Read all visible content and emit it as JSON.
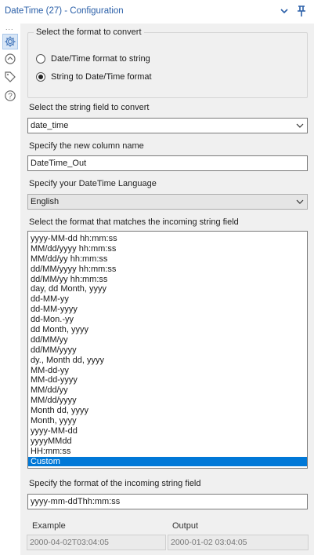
{
  "header": {
    "title": "DateTime (27) - Configuration",
    "collapse_icon": "chevron-down-icon",
    "pin_icon": "pin-icon"
  },
  "sidebar": {
    "more": "...",
    "icons": [
      "gear-icon",
      "connection-icon",
      "tag-icon",
      "help-icon"
    ]
  },
  "config": {
    "group_title": "Select the format to convert",
    "radio_options": [
      {
        "label": "Date/Time format to string",
        "selected": false
      },
      {
        "label": "String to Date/Time format",
        "selected": true
      }
    ],
    "string_field_label": "Select the string field to convert",
    "string_field_value": "date_time",
    "new_column_label": "Specify the new column name",
    "new_column_value": "DateTime_Out",
    "language_label": "Specify your DateTime Language",
    "language_value": "English",
    "format_list_label": "Select the format that matches the incoming string field",
    "formats": [
      "yyyy-MM-dd hh:mm:ss",
      "MM/dd/yyyy hh:mm:ss",
      "MM/dd/yy hh:mm:ss",
      "dd/MM/yyyy hh:mm:ss",
      "dd/MM/yy hh:mm:ss",
      "day, dd Month, yyyy",
      "dd-MM-yy",
      "dd-MM-yyyy",
      "dd-Mon.-yy",
      "dd Month, yyyy",
      "dd/MM/yy",
      "dd/MM/yyyy",
      "dy., Month dd, yyyy",
      "MM-dd-yy",
      "MM-dd-yyyy",
      "MM/dd/yy",
      "MM/dd/yyyy",
      "Month dd, yyyy",
      "Month, yyyy",
      "yyyy-MM-dd",
      "yyyyMMdd",
      "HH:mm:ss",
      "Custom"
    ],
    "selected_format": "Custom",
    "custom_format_label": "Specify the format of the incoming string field",
    "custom_format_value": "yyyy-mm-ddThh:mm:ss",
    "example_label": "Example",
    "example_value": "2000-04-02T03:04:05",
    "output_label": "Output",
    "output_value": "2000-01-02 03:04:05"
  },
  "colors": {
    "title": "#2a5fa8",
    "selection": "#0078d7",
    "panel_bg": "#f0f0f0"
  }
}
